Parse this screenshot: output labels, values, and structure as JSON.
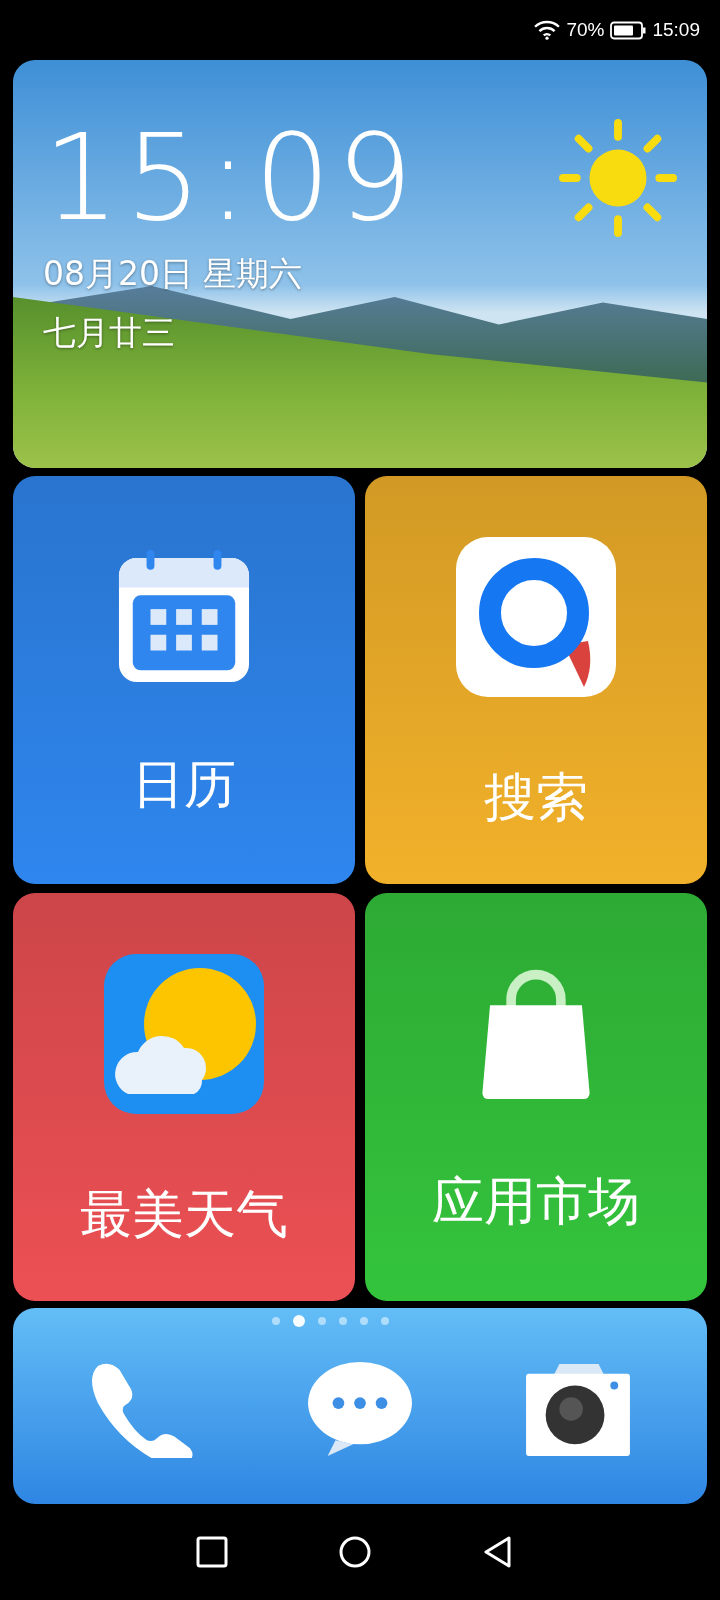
{
  "status_bar": {
    "battery": "70%",
    "time": "15:09"
  },
  "clock_widget": {
    "time": "15:09",
    "date": "08月20日 星期六",
    "lunar_date": "七月廿三"
  },
  "tiles": [
    {
      "kind": "calendar",
      "label": "日历",
      "color": "#2f86ee"
    },
    {
      "kind": "search",
      "label": "搜索",
      "color": "#f2b12a"
    },
    {
      "kind": "weather",
      "label": "最美天气",
      "color": "#ec5054"
    },
    {
      "kind": "store",
      "label": "应用市场",
      "color": "#34c43c"
    }
  ],
  "page_indicator": [
    {
      "selected": false
    },
    {
      "selected": true
    },
    {
      "selected": false
    },
    {
      "selected": false
    },
    {
      "selected": false
    },
    {
      "selected": false
    }
  ],
  "dock": [
    {
      "kind": "phone"
    },
    {
      "kind": "messages"
    },
    {
      "kind": "camera"
    }
  ]
}
